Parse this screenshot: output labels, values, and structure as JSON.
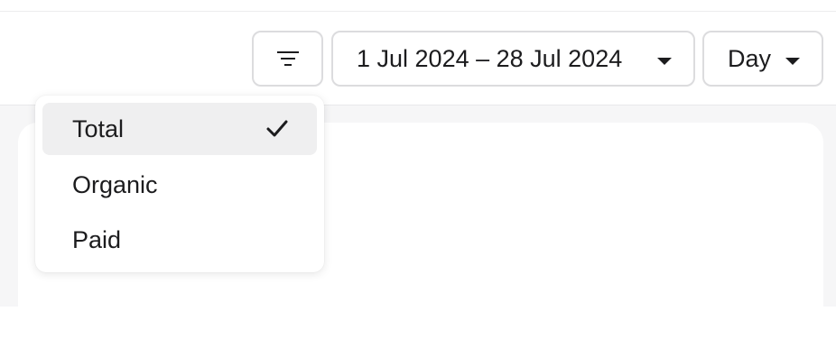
{
  "toolbar": {
    "filter_icon": "filter-lines-icon",
    "date_range": "1 Jul 2024 – 28 Jul 2024",
    "date_caret_icon": "caret-down-icon",
    "granularity": "Day",
    "granularity_caret_icon": "caret-down-icon"
  },
  "filter_menu": {
    "items": [
      {
        "label": "Total",
        "selected": true
      },
      {
        "label": "Organic",
        "selected": false
      },
      {
        "label": "Paid",
        "selected": false
      }
    ],
    "check_icon": "checkmark-icon"
  },
  "colors": {
    "border": "#dcdcde",
    "selected_bg": "#efeff0",
    "content_bg": "#f6f6f7",
    "text": "#1c1c1e"
  }
}
